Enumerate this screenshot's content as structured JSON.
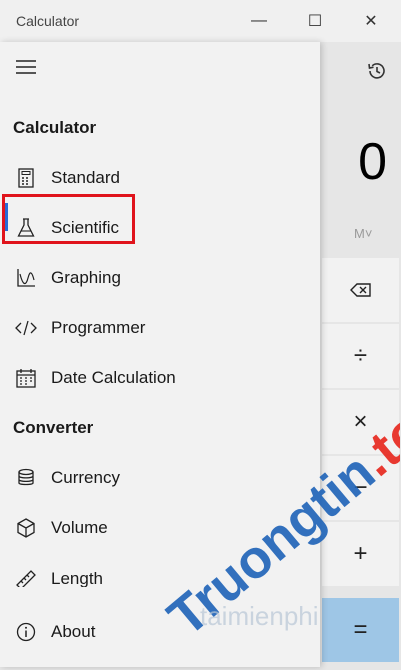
{
  "window": {
    "title": "Calculator",
    "minimize_glyph": "—",
    "maximize_glyph": "☐",
    "close_glyph": "✕"
  },
  "nav": {
    "calculator_header": "Calculator",
    "converter_header": "Converter",
    "items": [
      {
        "label": "Standard",
        "icon": "standard-calculator-icon",
        "selected": true
      },
      {
        "label": "Scientific",
        "icon": "flask-icon"
      },
      {
        "label": "Graphing",
        "icon": "graph-icon"
      },
      {
        "label": "Programmer",
        "icon": "code-icon"
      },
      {
        "label": "Date Calculation",
        "icon": "calendar-icon"
      }
    ],
    "converter_items": [
      {
        "label": "Currency",
        "icon": "coins-icon"
      },
      {
        "label": "Volume",
        "icon": "cube-icon"
      },
      {
        "label": "Length",
        "icon": "ruler-icon"
      }
    ],
    "about": {
      "label": "About",
      "icon": "info-icon"
    }
  },
  "calculator": {
    "display": "0",
    "memory_label": "M˅",
    "keys": [
      "⌫",
      "÷",
      "×",
      "−",
      "+",
      "="
    ]
  },
  "watermark": {
    "brand": "Truongtin.top",
    "sub": "taimienphi"
  },
  "colors": {
    "accent": "#2a6bd4",
    "highlight": "#e0141c",
    "equals_key": "#9ec6e6",
    "watermark_blue": "#1e63b8",
    "watermark_red": "#e8251c"
  }
}
